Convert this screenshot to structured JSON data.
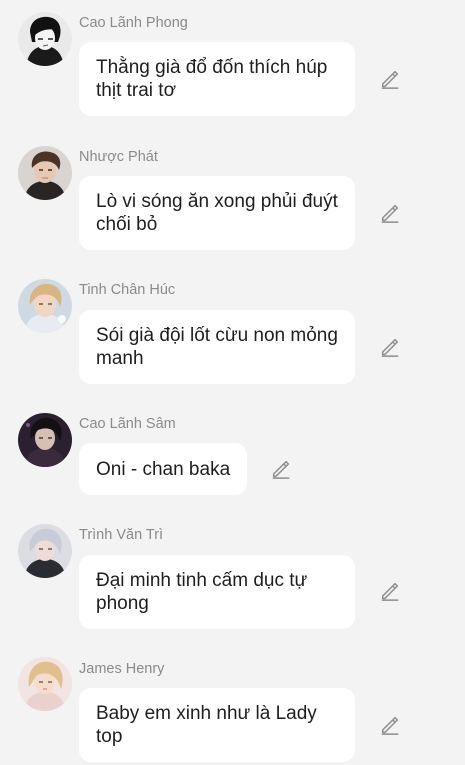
{
  "messages": [
    {
      "sender": "Cao Lãnh Phong",
      "text": "Thằng già đổ đốn thích húp thịt trai tơ",
      "avatar_icon": "avatar-dark-hair-sketch"
    },
    {
      "sender": "Nhược Phát",
      "text": "Lò vi sóng ăn xong phủi đuýt chối bỏ",
      "avatar_icon": "avatar-brown-hair"
    },
    {
      "sender": "Tinh Chân Húc",
      "text": "Sói già đội lốt cừu non mỏng manh",
      "avatar_icon": "avatar-blonde-hair"
    },
    {
      "sender": "Cao Lãnh Sâm",
      "text": "Oni - chan baka",
      "avatar_icon": "avatar-dark-purple"
    },
    {
      "sender": "Trình Văn Trì",
      "text": "Đại minh tinh cấm dục tự phong",
      "avatar_icon": "avatar-silver-hair"
    },
    {
      "sender": "James Henry",
      "text": "Baby em xinh như là Lady top",
      "avatar_icon": "avatar-blonde-pink"
    }
  ],
  "colors": {
    "background": "#f3f3f3",
    "bubble": "#ffffff",
    "sender_text": "#8a8a8a",
    "message_text": "#1e1e1e",
    "edit_icon": "#8c8c8c"
  }
}
